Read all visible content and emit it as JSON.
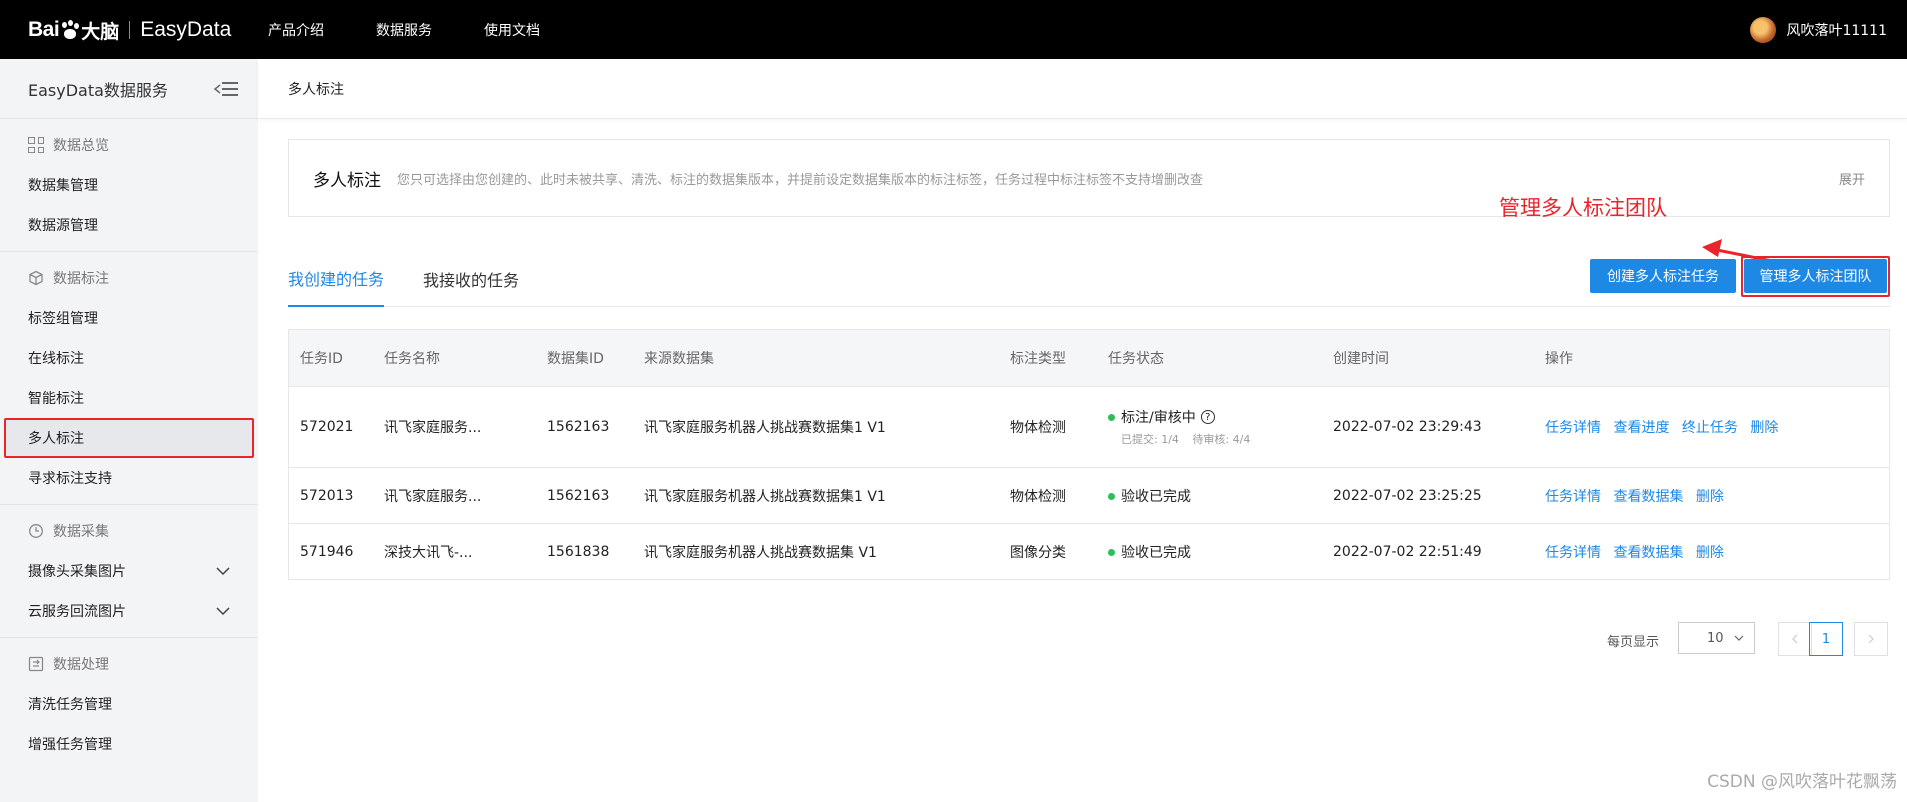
{
  "topbar": {
    "logo_bai": "Bai",
    "logo_da": "大脑",
    "logo_product": "EasyData",
    "nav": [
      "产品介绍",
      "数据服务",
      "使用文档"
    ],
    "username": "风吹落叶11111"
  },
  "sidebar": {
    "title": "EasyData数据服务",
    "groups": [
      {
        "title": "数据总览",
        "icon": "grid-icon",
        "items": [
          "数据集管理",
          "数据源管理"
        ]
      },
      {
        "title": "数据标注",
        "icon": "cube-icon",
        "items": [
          "标签组管理",
          "在线标注",
          "智能标注",
          "多人标注",
          "寻求标注支持"
        ]
      },
      {
        "title": "数据采集",
        "icon": "clock-icon",
        "items": [
          "摄像头采集图片",
          "云服务回流图片"
        ]
      },
      {
        "title": "数据处理",
        "icon": "process-icon",
        "items": [
          "清洗任务管理",
          "增强任务管理"
        ]
      }
    ]
  },
  "main": {
    "breadcrumb": "多人标注",
    "intro": {
      "title": "多人标注",
      "desc": "您只可选择由您创建的、此时未被共享、清洗、标注的数据集版本，并提前设定数据集版本的标注标签，任务过程中标注标签不支持增删改查",
      "expand": "展开"
    },
    "annotation": "管理多人标注团队",
    "tabs": [
      "我创建的任务",
      "我接收的任务"
    ],
    "buttons": {
      "create": "创建多人标注任务",
      "manage": "管理多人标注团队"
    },
    "table": {
      "headers": [
        "任务ID",
        "任务名称",
        "数据集ID",
        "来源数据集",
        "标注类型",
        "任务状态",
        "创建时间",
        "操作"
      ],
      "rows": [
        {
          "id": "572021",
          "name": "讯飞家庭服务...",
          "dataset_id": "1562163",
          "source": "讯飞家庭服务机器人挑战赛数据集1 V1",
          "type": "物体检测",
          "status": "标注/审核中",
          "submitted": "已提交: 1/4",
          "pending": "待审核: 4/4",
          "created": "2022-07-02 23:29:43",
          "ops": [
            "任务详情",
            "查看进度",
            "终止任务",
            "删除"
          ]
        },
        {
          "id": "572013",
          "name": "讯飞家庭服务...",
          "dataset_id": "1562163",
          "source": "讯飞家庭服务机器人挑战赛数据集1 V1",
          "type": "物体检测",
          "status": "验收已完成",
          "created": "2022-07-02 23:25:25",
          "ops": [
            "任务详情",
            "查看数据集",
            "删除"
          ]
        },
        {
          "id": "571946",
          "name": "深技大讯飞-...",
          "dataset_id": "1561838",
          "source": "讯飞家庭服务机器人挑战赛数据集 V1",
          "type": "图像分类",
          "status": "验收已完成",
          "created": "2022-07-02 22:51:49",
          "ops": [
            "任务详情",
            "查看数据集",
            "删除"
          ]
        }
      ]
    },
    "pagination": {
      "label": "每页显示",
      "page_size": "10",
      "current_page": "1"
    }
  },
  "watermark": "CSDN @风吹落叶花飘荡",
  "colors": {
    "accent": "#1e88e5",
    "highlight": "#e8252b",
    "success": "#2dbd5a"
  }
}
